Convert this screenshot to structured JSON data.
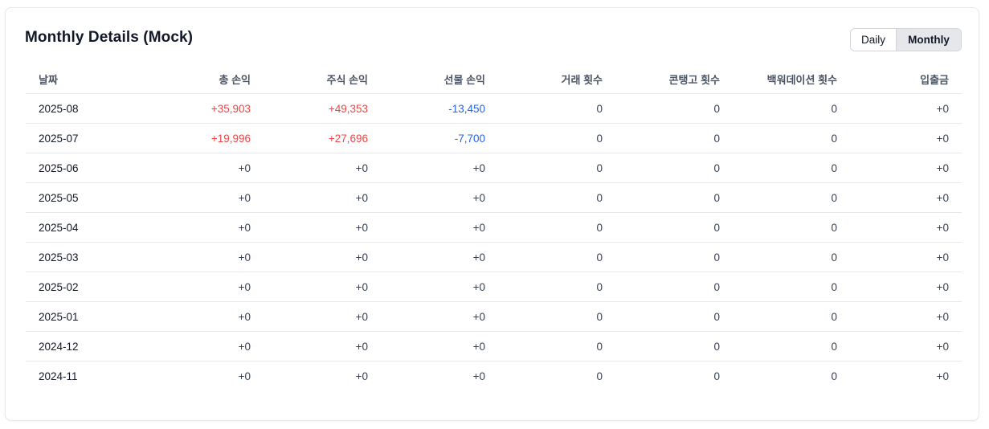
{
  "header": {
    "title": "Monthly Details (Mock)",
    "toggle": {
      "options": [
        "Daily",
        "Monthly"
      ],
      "selected": "Monthly"
    }
  },
  "table": {
    "columns": [
      "날짜",
      "총 손익",
      "주식 손익",
      "선물 손익",
      "거래 횟수",
      "콘탱고 횟수",
      "백워데이션 횟수",
      "입출금"
    ],
    "rows": [
      [
        "2025-08",
        "+35,903",
        "+49,353",
        "-13,450",
        "0",
        "0",
        "0",
        "+0"
      ],
      [
        "2025-07",
        "+19,996",
        "+27,696",
        "-7,700",
        "0",
        "0",
        "0",
        "+0"
      ],
      [
        "2025-06",
        "+0",
        "+0",
        "+0",
        "0",
        "0",
        "0",
        "+0"
      ],
      [
        "2025-05",
        "+0",
        "+0",
        "+0",
        "0",
        "0",
        "0",
        "+0"
      ],
      [
        "2025-04",
        "+0",
        "+0",
        "+0",
        "0",
        "0",
        "0",
        "+0"
      ],
      [
        "2025-03",
        "+0",
        "+0",
        "+0",
        "0",
        "0",
        "0",
        "+0"
      ],
      [
        "2025-02",
        "+0",
        "+0",
        "+0",
        "0",
        "0",
        "0",
        "+0"
      ],
      [
        "2025-01",
        "+0",
        "+0",
        "+0",
        "0",
        "0",
        "0",
        "+0"
      ],
      [
        "2024-12",
        "+0",
        "+0",
        "+0",
        "0",
        "0",
        "0",
        "+0"
      ],
      [
        "2024-11",
        "+0",
        "+0",
        "+0",
        "0",
        "0",
        "0",
        "+0"
      ]
    ]
  },
  "colors": {
    "positive": "#ef4444",
    "negative": "#2563eb",
    "border": "#e5e7eb",
    "toggle_selected_bg": "#e5e7eb"
  }
}
